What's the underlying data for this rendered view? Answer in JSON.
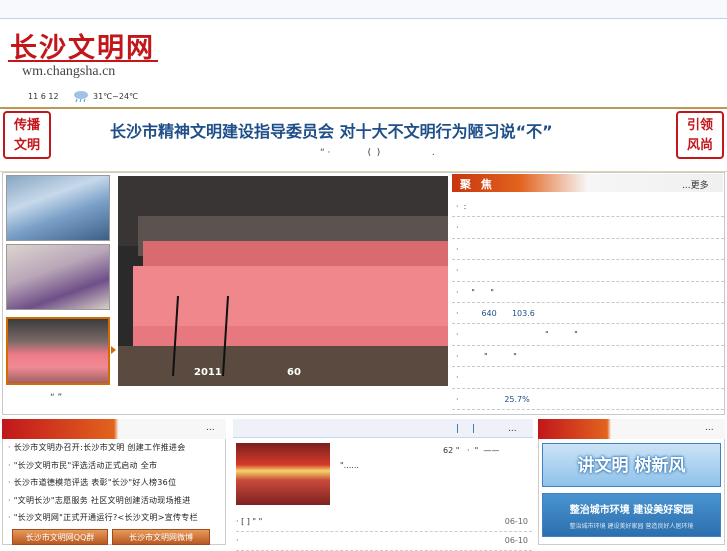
{
  "header": {
    "logo_cn": "长沙文明网",
    "logo_en": "wm.changsha.cn",
    "date": "11 6 12",
    "weather_icon": "cloud-rain-icon",
    "temperature": "31℃~24℃"
  },
  "banner": {
    "seal_left": "传播\n文明",
    "seal_right": "引领\n风尚",
    "headline": "长沙市精神文明建设指导委员会 对十大不文明行为陋习说“不”",
    "subline": "“ ·             (  )                  ."
  },
  "slideshow": {
    "caption_year": "2011",
    "caption_num": "60",
    "caption_below": "“  ”"
  },
  "focus": {
    "title": "聚 焦",
    "more": "...更多",
    "items": [
      {
        "text": "·  :",
        "value": ""
      },
      {
        "text": "·",
        "value": ""
      },
      {
        "text": "·",
        "value": ""
      },
      {
        "text": "·",
        "value": ""
      },
      {
        "text": "·     \"      \"",
        "value": ""
      },
      {
        "text": "·         ",
        "value": "640      103.6"
      },
      {
        "text": "·                                  \"          \"",
        "value": ""
      },
      {
        "text": "·          \"          \"",
        "value": ""
      },
      {
        "text": "·",
        "value": ""
      },
      {
        "text": "·                  ",
        "value": "25.7%"
      }
    ]
  },
  "left_column": {
    "more": "...",
    "items": [
      "长沙市文明办召开:长沙市文明 创建工作推进会",
      "\"长沙文明市民\"评选活动正式启动 全市",
      "长沙市道德模范评选 表彰\"长沙\"好人榜36位",
      "\"文明长沙\"志愿服务 社区文明创建活动现场推进",
      "\"长沙文明网\"正式开通运行?<长沙文明>宣传专栏"
    ],
    "button1": "长沙市文明网QQ群",
    "button2": "长沙市文明网微博"
  },
  "middle_column": {
    "tab_pipes": [
      "|",
      "|"
    ],
    "more": "...",
    "top_line": "62 \"   ·  \"  ——",
    "thumb_text": "\"......",
    "rows": [
      {
        "text": "· [ ] \"        \"",
        "date": "06-10"
      },
      {
        "text": "·",
        "date": "06-10"
      }
    ]
  },
  "right_column": {
    "more": "...",
    "banner1": "讲文明 树新风",
    "banner2": "整治城市环境 建设美好家园",
    "banner2_small": "整治城市环境 建设美好家园 营造良好人居环境"
  }
}
